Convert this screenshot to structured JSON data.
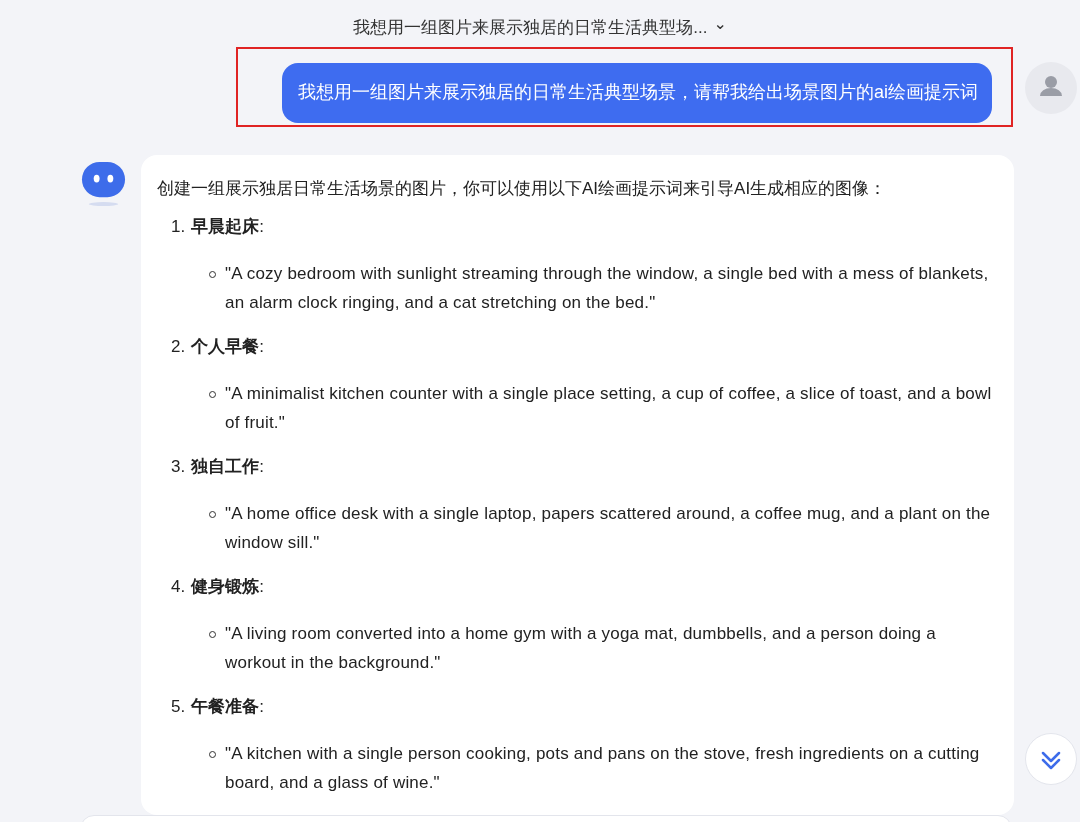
{
  "header": {
    "title": "我想用一组图片来展示独居的日常生活典型场...",
    "expand_icon": "⌄"
  },
  "user_message": {
    "text": "我想用一组图片来展示独居的日常生活典型场景，请帮我给出场景图片的ai绘画提示词",
    "highlighted": true
  },
  "answer": {
    "intro": "创建一组展示独居日常生活场景的图片，你可以使用以下AI绘画提示词来引导AI生成相应的图像：",
    "items": [
      {
        "number": "1.",
        "title": "**早晨起床**:",
        "bullets": [
          "\"A cozy bedroom with sunlight streaming through the window, a single bed with a mess of blankets, an alarm clock ringing, and a cat stretching on the bed.\""
        ]
      },
      {
        "number": "2.",
        "title": "**个人早餐**:",
        "bullets": [
          "\"A minimalist kitchen counter with a single place setting, a cup of coffee, a slice of toast, and a bowl of fruit.\""
        ]
      },
      {
        "number": "3.",
        "title": "**独自工作**:",
        "bullets": [
          "\"A home office desk with a single laptop, papers scattered around, a coffee mug, and a plant on the window sill.\""
        ]
      },
      {
        "number": "4.",
        "title": "**健身锻炼**:",
        "bullets": [
          "\"A living room converted into a home gym with a yoga mat, dumbbells, and a person doing a workout in the background.\""
        ]
      },
      {
        "number": "5.",
        "title": "**午餐准备**:",
        "bullets": [
          "\"A kitchen with a single person cooking, pots and pans on the stove, fresh ingredients on a cutting board, and a glass of wine.\""
        ]
      }
    ]
  }
}
